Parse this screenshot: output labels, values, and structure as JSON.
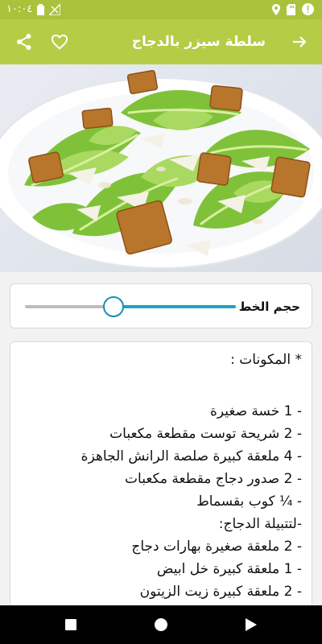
{
  "status_bar": {
    "time": "١٠:٠٤"
  },
  "app_bar": {
    "title": "سلطة سيزر بالدجاج",
    "icons": [
      "arrow-forward-icon",
      "heart-outline-icon",
      "share-icon"
    ]
  },
  "hero_image": {
    "alt": "سلطة سيزر بالدجاج"
  },
  "font_size": {
    "label": "حجم الخط",
    "value_percent": 58
  },
  "ingredients": {
    "title": "* المكونات :",
    "items": [
      "- 1 خسة صغيرة",
      "- 2 شريحة توست مقطعة مكعبات",
      "- 4 ملعقة كبيرة صلصة الرانش الجاهزة",
      "- 2 صدور دجاج مقطعة مكعبات",
      "- ¼ كوب بقسماط",
      "-لتتبيلة الدجاج:",
      "- 2 ملعقة صغيرة بهارات دجاج",
      "- 1 ملعقة كبيرة خل ابيض",
      "- 2 ملعقة كبيرة زيت الزيتون"
    ]
  },
  "nav_bar": {
    "buttons": [
      "recents-square-icon",
      "home-circle-icon",
      "back-triangle-icon"
    ]
  },
  "colors": {
    "accent": "#b5cc46",
    "status": "#a8c23c",
    "slider": "#1fa2c8"
  }
}
